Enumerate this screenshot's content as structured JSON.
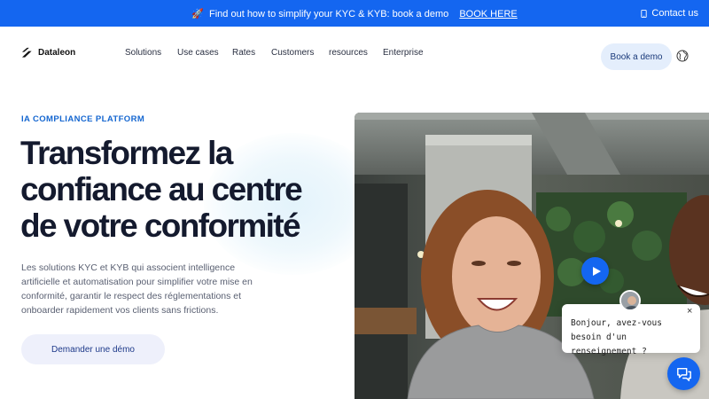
{
  "announcement": {
    "rocket_icon": "🚀",
    "text": "Find out how to simplify your KYC & KYB: book a demo",
    "link": "BOOK HERE",
    "contact": "Contact us"
  },
  "brand": {
    "name": "Dataleon"
  },
  "nav": {
    "items": [
      "Solutions",
      "Use cases",
      "Rates",
      "Customers",
      "resources",
      "Enterprise"
    ],
    "book_demo": "Book a demo"
  },
  "hero": {
    "eyebrow": "IA COMPLIANCE PLATFORM",
    "headline_line1": "Transformez la",
    "headline_line2": "confiance au centre",
    "headline_line3": "de votre conformité",
    "description": "Les solutions KYC et KYB qui associent intelligence artificielle et automatisation pour simplifier votre mise en conformité, garantir le respect des réglementations et onboarder rapidement vos clients sans frictions.",
    "cta": "Demander une démo"
  },
  "chat": {
    "close": "×",
    "message": "Bonjour, avez-vous besoin d'un renseignement ?"
  },
  "colors": {
    "accent": "#1466f0",
    "text": "#141a2e",
    "eyebrow": "#1466d0"
  }
}
